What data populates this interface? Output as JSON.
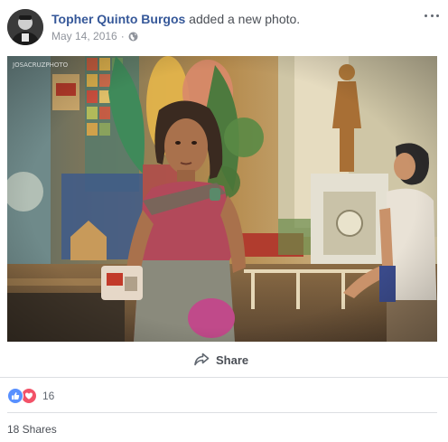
{
  "post": {
    "author": {
      "name": "Topher Quinto Burgos",
      "action": "added a new photo."
    },
    "timestamp": "May 14, 2016",
    "separator": "·",
    "audience_icon": "globe-icon",
    "menu_icon": "more-options-icon"
  },
  "photo": {
    "watermark": "JOSACRUZPHOTO",
    "subject": "photo-girl-street-scene"
  },
  "actions": {
    "share_label": "Share",
    "share_icon": "share-arrow-icon"
  },
  "reactions": {
    "icons": [
      "like-icon",
      "love-icon"
    ],
    "count": "16"
  },
  "shares": {
    "label": "18 Shares"
  },
  "colors": {
    "link": "#365899",
    "muted": "#90949c",
    "divider": "#dddfe2",
    "like": "#5890ff",
    "love": "#f25268"
  }
}
